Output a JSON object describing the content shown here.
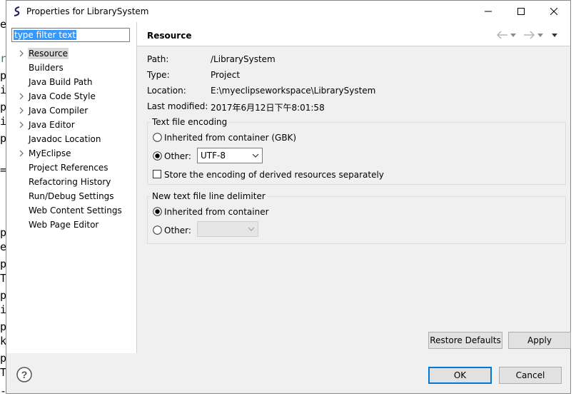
{
  "background_editor": {
    "lines": [
      "e",
      "r",
      "p",
      "i",
      "p",
      "i",
      "p",
      "=",
      "p",
      "e",
      "p",
      "T",
      "p",
      "i",
      "p",
      "k",
      "p",
      "T",
      "-"
    ]
  },
  "window": {
    "title": "Properties for LibrarySystem",
    "controls": {
      "minimize_icon": "minimize-icon",
      "maximize_icon": "maximize-icon",
      "close_icon": "close-icon"
    }
  },
  "filter": {
    "value": "type filter text"
  },
  "tree": {
    "items": [
      {
        "label": "Resource",
        "expandable": true,
        "selected": true
      },
      {
        "label": "Builders",
        "expandable": false
      },
      {
        "label": "Java Build Path",
        "expandable": false
      },
      {
        "label": "Java Code Style",
        "expandable": true
      },
      {
        "label": "Java Compiler",
        "expandable": true
      },
      {
        "label": "Java Editor",
        "expandable": true
      },
      {
        "label": "Javadoc Location",
        "expandable": false
      },
      {
        "label": "MyEclipse",
        "expandable": true
      },
      {
        "label": "Project References",
        "expandable": false
      },
      {
        "label": "Refactoring History",
        "expandable": false
      },
      {
        "label": "Run/Debug Settings",
        "expandable": false
      },
      {
        "label": "Web Content Settings",
        "expandable": false
      },
      {
        "label": "Web Page Editor",
        "expandable": false
      }
    ]
  },
  "page": {
    "title": "Resource",
    "info": [
      {
        "label": "Path:",
        "value": "/LibrarySystem"
      },
      {
        "label": "Type:",
        "value": "Project"
      },
      {
        "label": "Location:",
        "value": "E:\\myeclipseworkspace\\LibrarySystem"
      },
      {
        "label": "Last modified:",
        "value": "2017年6月12日下午8:01:58"
      }
    ],
    "encoding": {
      "title": "Text file encoding",
      "inherited_label": "Inherited from container (GBK)",
      "other_label": "Other:",
      "other_value": "UTF-8",
      "store_label": "Store the encoding of derived resources separately"
    },
    "delimiter": {
      "title": "New text file line delimiter",
      "inherited_label": "Inherited from container",
      "other_label": "Other:"
    }
  },
  "buttons": {
    "restore_defaults": "Restore Defaults",
    "apply": "Apply",
    "ok": "OK",
    "cancel": "Cancel"
  },
  "colors": {
    "accent": "#0078d7",
    "selection": "#3399ff"
  }
}
